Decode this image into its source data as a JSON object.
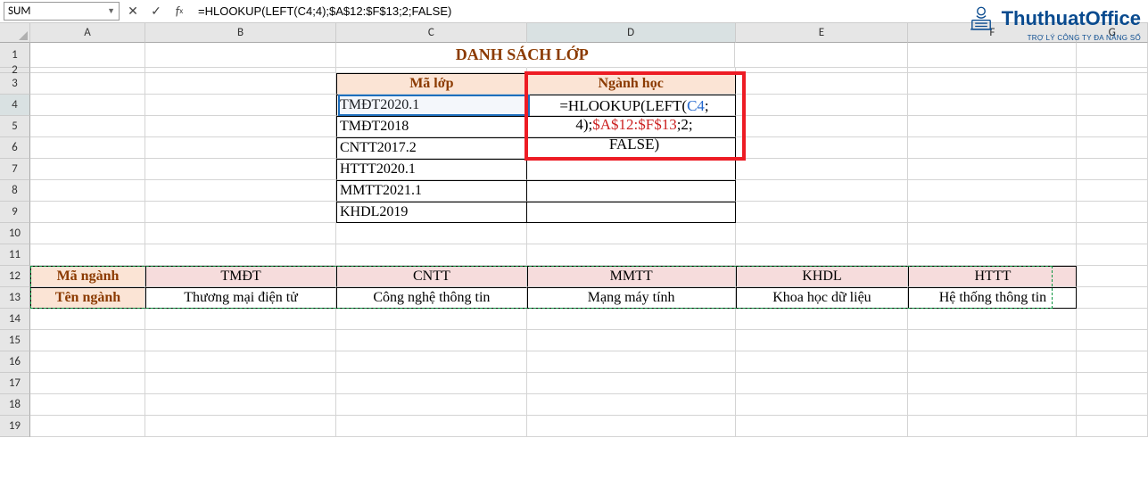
{
  "namebox": "SUM",
  "formula_bar": "=HLOOKUP(LEFT(C4;4);$A$12:$F$13;2;FALSE)",
  "columns": [
    "A",
    "B",
    "C",
    "D",
    "E",
    "F",
    "G"
  ],
  "rows": [
    "1",
    "2",
    "3",
    "4",
    "5",
    "6",
    "7",
    "8",
    "9",
    "10",
    "11",
    "12",
    "13",
    "14",
    "15",
    "16",
    "17",
    "18",
    "19"
  ],
  "title": "DANH SÁCH LỚP",
  "header_upper": {
    "c": "Mã lớp",
    "d": "Ngành học"
  },
  "classes": [
    "TMĐT2020.1",
    "TMĐT2018",
    "CNTT2017.2",
    "HTTT2020.1",
    "MMTT2021.1",
    "KHDL2019"
  ],
  "formula_tokens": {
    "p1": "=HLOOKUP(LEFT(",
    "ref1": "C4",
    "p2": ";",
    "p3": "4);",
    "ref2": "$A$12:$F$13",
    "p4": ";2;",
    "p5": "FALSE)"
  },
  "lookup_table": {
    "row_hdr1": "Mã ngành",
    "row_hdr2": "Tên ngành",
    "codes": [
      "TMĐT",
      "CNTT",
      "MMTT",
      "KHDL",
      "HTTT"
    ],
    "names": [
      "Thương mại điện tử",
      "Công nghệ thông tin",
      "Mạng máy tính",
      "Khoa học dữ liệu",
      "Hệ thống thông tin"
    ]
  },
  "watermark": {
    "name": "ThuthuatOffice",
    "sub": "TRỢ LÝ CÔNG TY ĐA NĂNG SỐ"
  },
  "chart_data": {
    "type": "table",
    "title": "DANH SÁCH LỚP",
    "active_cell": "D4",
    "formula": "=HLOOKUP(LEFT(C4;4);$A$12:$F$13;2;FALSE)",
    "list": [
      {
        "Mã lớp": "TMĐT2020.1"
      },
      {
        "Mã lớp": "TMĐT2018"
      },
      {
        "Mã lớp": "CNTT2017.2"
      },
      {
        "Mã lớp": "HTTT2020.1"
      },
      {
        "Mã lớp": "MMTT2021.1"
      },
      {
        "Mã lớp": "KHDL2019"
      }
    ],
    "lookup": {
      "Mã ngành": [
        "TMĐT",
        "CNTT",
        "MMTT",
        "KHDL",
        "HTTT"
      ],
      "Tên ngành": [
        "Thương mại điện tử",
        "Công nghệ thông tin",
        "Mạng máy tính",
        "Khoa học dữ liệu",
        "Hệ thống thông tin"
      ]
    }
  }
}
